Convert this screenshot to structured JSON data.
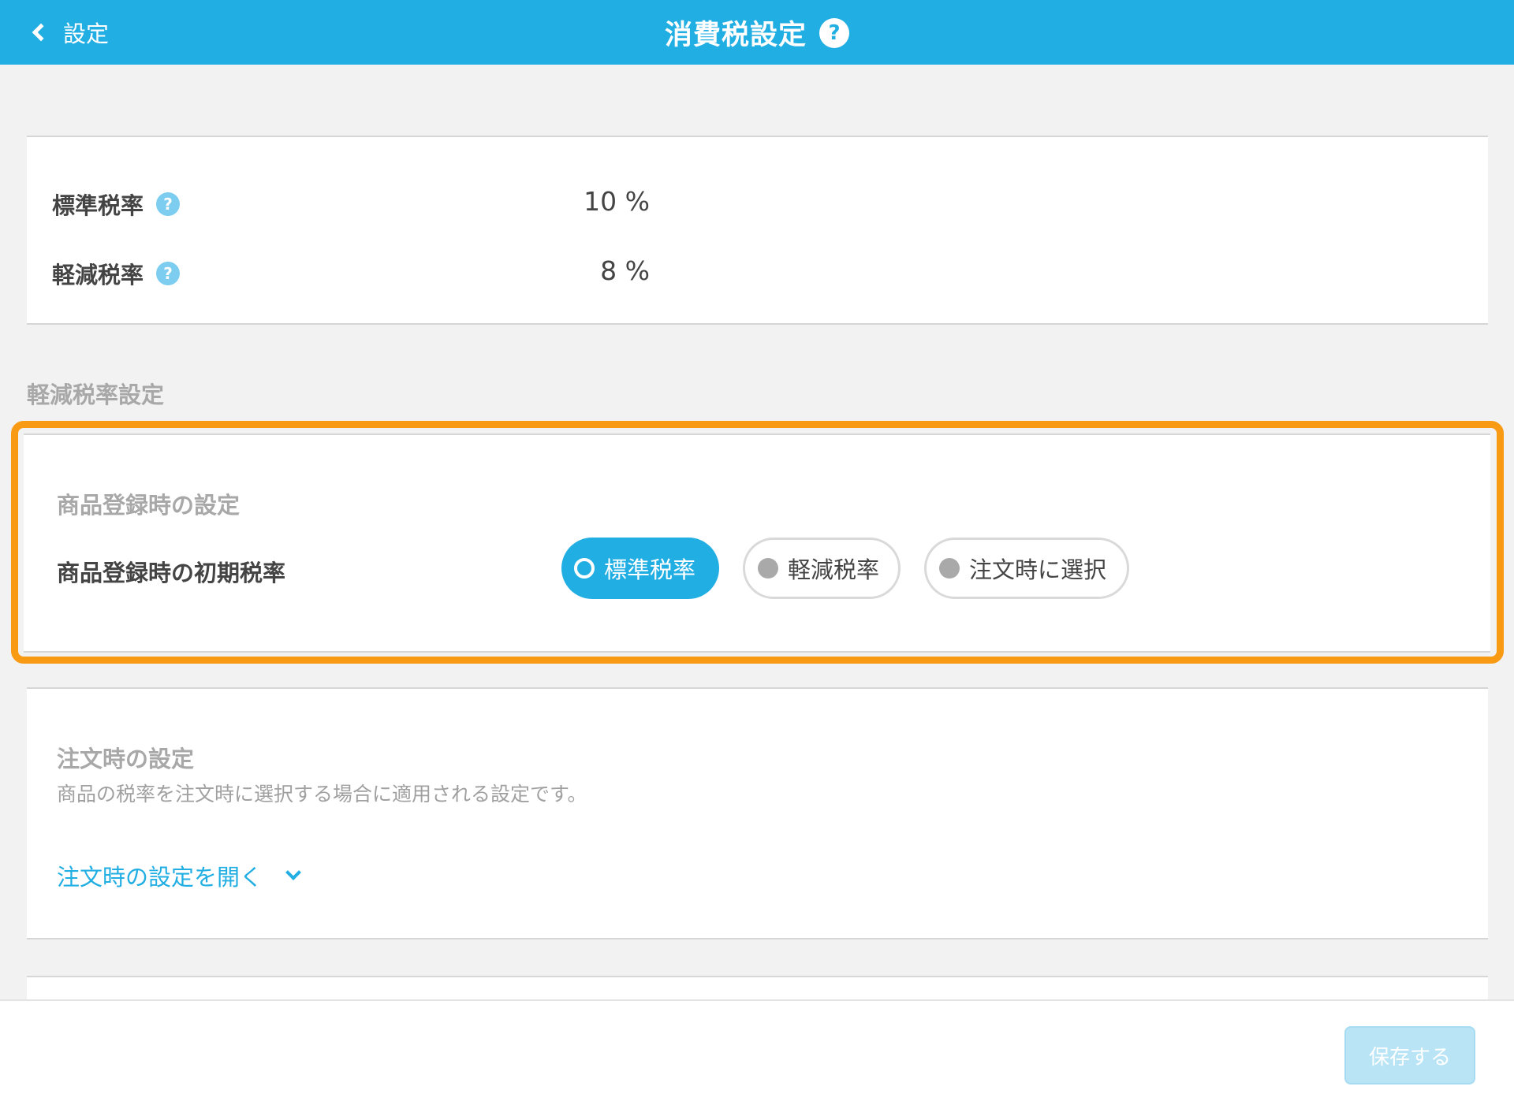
{
  "header": {
    "back_label": "設定",
    "title": "消費税設定",
    "help": "?"
  },
  "rates": [
    {
      "label": "標準税率",
      "help": "?",
      "value": "10 %"
    },
    {
      "label": "軽減税率",
      "help": "?",
      "value": "8 %"
    }
  ],
  "reduced_section": {
    "title": "軽減税率設定"
  },
  "registration": {
    "subtitle": "商品登録時の設定",
    "field_label": "商品登録時の初期税率",
    "options": [
      {
        "label": "標準税率",
        "selected": true
      },
      {
        "label": "軽減税率",
        "selected": false
      },
      {
        "label": "注文時に選択",
        "selected": false
      }
    ]
  },
  "order": {
    "subtitle": "注文時の設定",
    "description": "商品の税率を注文時に選択する場合に適用される設定です。",
    "open_label": "注文時の設定を開く"
  },
  "footer": {
    "save_label": "保存する"
  },
  "colors": {
    "accent": "#21aee3",
    "highlight": "#f99a14"
  }
}
